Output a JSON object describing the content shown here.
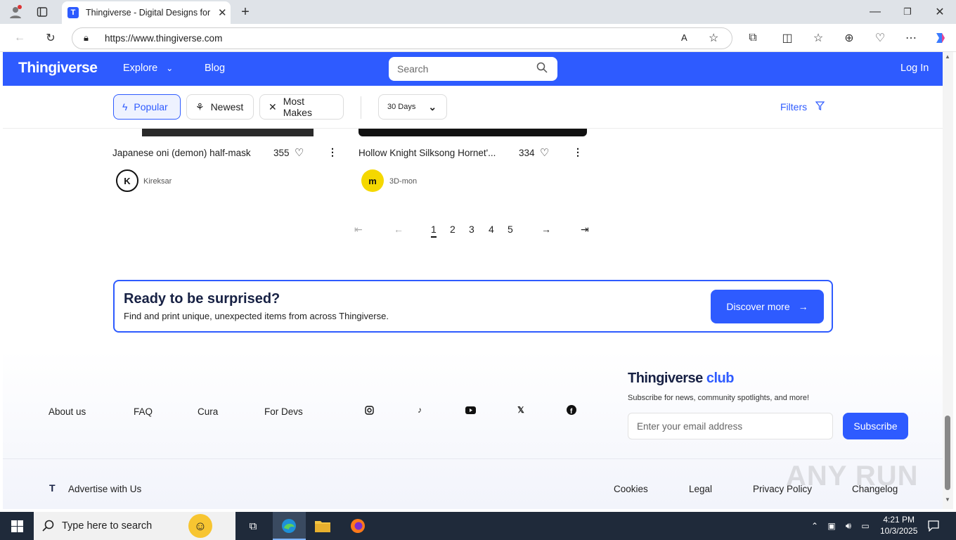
{
  "browser": {
    "tab_title": "Thingiverse - Digital Designs for P",
    "url": "https://www.thingiverse.com"
  },
  "site": {
    "logo": "Thingiverse",
    "nav": {
      "explore": "Explore",
      "blog": "Blog",
      "login": "Log In"
    },
    "search_placeholder": "Search",
    "accent_color": "#2e5bff"
  },
  "filters": {
    "chips": [
      {
        "label": "Popular",
        "active": true
      },
      {
        "label": "Newest",
        "active": false
      },
      {
        "label": "Most Makes",
        "active": false
      }
    ],
    "period": "30 Days",
    "filters_label": "Filters"
  },
  "cards": [
    {
      "title": "Japanese oni (demon) half-mask",
      "likes": "355",
      "author": "Kireksar"
    },
    {
      "title": "Hollow Knight Silksong Hornet'...",
      "likes": "334",
      "author": "3D-mon"
    }
  ],
  "pagination": {
    "pages": [
      "1",
      "2",
      "3",
      "4",
      "5"
    ],
    "current": "1"
  },
  "promo": {
    "title": "Ready to be surprised?",
    "subtitle": "Find and print unique, unexpected items from across Thingiverse.",
    "button": "Discover more"
  },
  "footer": {
    "links": [
      "About us",
      "FAQ",
      "Cura",
      "For Devs"
    ],
    "social": [
      "instagram-icon",
      "tiktok-icon",
      "youtube-icon",
      "x-icon",
      "facebook-icon"
    ],
    "club_title_main": "Thingiverse",
    "club_title_accent": "club",
    "club_subtitle": "Subscribe for news, community spotlights, and more!",
    "email_placeholder": "Enter your email address",
    "subscribe": "Subscribe",
    "advertise": "Advertise with Us",
    "bottom_links": [
      "Cookies",
      "Legal",
      "Privacy Policy",
      "Changelog"
    ]
  },
  "taskbar": {
    "search_placeholder": "Type here to search",
    "time": "4:21 PM",
    "date": "10/3/2025"
  },
  "watermark": "ANY RUN"
}
